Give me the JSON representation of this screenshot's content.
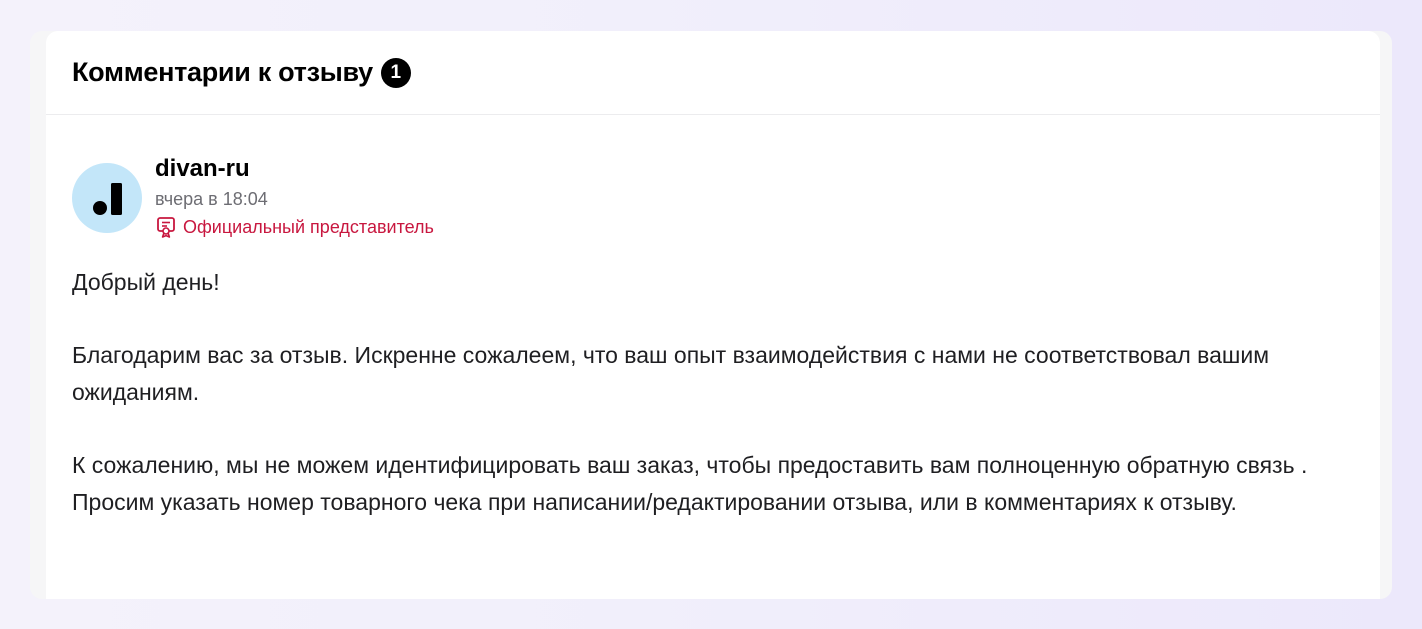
{
  "header": {
    "title": "Комментарии к отзыву",
    "count": "1"
  },
  "comment": {
    "author": "divan-ru",
    "time": "вчера в 18:04",
    "role": "Официальный представитель",
    "paragraphs": [
      "Добрый день!",
      "Благодарим вас за отзыв. Искренне сожалеем, что ваш опыт взаимодействия с нами не соответствовал вашим ожиданиям.",
      "К сожалению, мы не можем идентифицировать ваш заказ, чтобы предоставить вам полноценную обратную связь . Просим указать номер товарного чека при написании/редактировании отзыва, или в комментариях к отзыву."
    ]
  },
  "icons": {
    "avatar": "divan-logo-icon",
    "official": "certificate-icon"
  },
  "colors": {
    "accent": "#c8173f",
    "avatar_bg": "#c3e6f9",
    "badge_bg": "#000000"
  }
}
